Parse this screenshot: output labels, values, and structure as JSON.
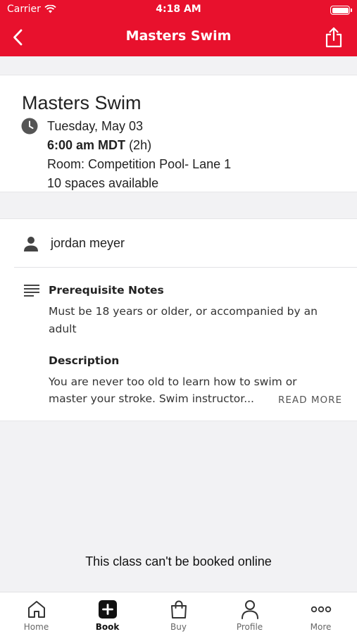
{
  "status_bar": {
    "carrier": "Carrier",
    "time": "4:18 AM"
  },
  "nav": {
    "title": "Masters Swim",
    "back_icon": "chevron-left-icon",
    "share_icon": "share-icon"
  },
  "class_info": {
    "title": "Masters Swim",
    "date": "Tuesday, May 03",
    "time": "6:00 am MDT",
    "duration": "(2h)",
    "room": "Room: Competition Pool- Lane 1",
    "spaces": "10 spaces available"
  },
  "instructor": {
    "name": "jordan meyer"
  },
  "prerequisite": {
    "heading": "Prerequisite Notes",
    "text": "Must be 18 years or older, or accompanied by an adult"
  },
  "description": {
    "heading": "Description",
    "line1": "You are never too old to learn how to swim or",
    "line2": "master your stroke. Swim instructor...",
    "read_more": "READ MORE"
  },
  "notice": "This class can't be booked online",
  "tabs": [
    {
      "label": "Home",
      "icon": "home-icon"
    },
    {
      "label": "Book",
      "icon": "plus-square-icon",
      "active": true
    },
    {
      "label": "Buy",
      "icon": "shopping-bag-icon"
    },
    {
      "label": "Profile",
      "icon": "person-icon"
    },
    {
      "label": "More",
      "icon": "more-dots-icon"
    }
  ],
  "colors": {
    "brand": "#e8112d"
  }
}
